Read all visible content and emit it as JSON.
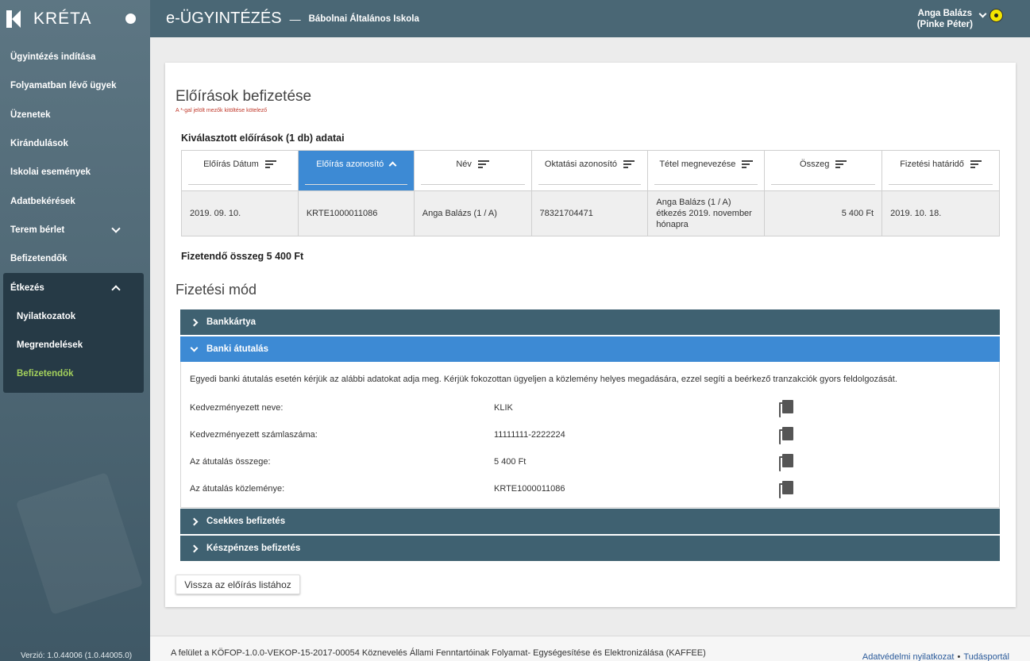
{
  "sidebar": {
    "logo": "KRÉTA",
    "items": [
      {
        "label": "Ügyintézés indítása"
      },
      {
        "label": "Folyamatban lévő ügyek"
      },
      {
        "label": "Üzenetek"
      },
      {
        "label": "Kirándulások"
      },
      {
        "label": "Iskolai események"
      },
      {
        "label": "Adatbekérések"
      },
      {
        "label": "Terem bérlet"
      },
      {
        "label": "Befizetendők"
      }
    ],
    "group": {
      "label": "Étkezés",
      "subitems": [
        {
          "label": "Nyilatkozatok"
        },
        {
          "label": "Megrendelések"
        },
        {
          "label": "Befizetendők"
        }
      ]
    },
    "version": "Verzió: 1.0.44006 (1.0.44005.0)"
  },
  "header": {
    "title": "e-ÜGYINTÉZÉS",
    "dash": "—",
    "school": "Bábolnai Általános Iskola",
    "user_name": "Anga Balázs",
    "user_sub": "(Pinke Péter)"
  },
  "page": {
    "title": "Előírások befizetése",
    "required_note": "A *-gal jelölt mezők kitöltése kötelező",
    "section_title": "Kiválasztott előírások (1 db) adatai",
    "columns": [
      "Előírás Dátum",
      "Előírás azonosító",
      "Név",
      "Oktatási azonosító",
      "Tétel megnevezése",
      "Összeg",
      "Fizetési határidő"
    ],
    "row": {
      "date": "2019. 09. 10.",
      "id": "KRTE1000011086",
      "name": "Anga Balázs (1 / A)",
      "edu_id": "78321704471",
      "item": "Anga Balázs (1 / A) étkezés 2019. november hónapra",
      "amount": "5 400 Ft",
      "deadline": "2019. 10. 18."
    },
    "total": "Fizetendő összeg 5 400 Ft",
    "payment_title": "Fizetési mód",
    "accordions": {
      "card": "Bankkártya",
      "transfer": "Banki átutalás",
      "cheque": "Csekkes befizetés",
      "cash": "Készpénzes befizetés"
    },
    "transfer": {
      "description": "Egyedi banki átutalás esetén kérjük az alábbi adatokat adja meg. Kérjük fokozottan ügyeljen a közlemény helyes megadására, ezzel segíti a beérkező tranzakciók gyors feldolgozását.",
      "fields": [
        {
          "label": "Kedvezményezett neve:",
          "value": "KLIK"
        },
        {
          "label": "Kedvezményezett számlaszáma:",
          "value": "11111111-2222224"
        },
        {
          "label": "Az átutalás összege:",
          "value": "5 400 Ft"
        },
        {
          "label": "Az átutalás közleménye:",
          "value": "KRTE1000011086"
        }
      ]
    },
    "back_button": "Vissza az előírás listához"
  },
  "footer": {
    "text": "A felület a KÖFOP-1.0.0-VEKOP-15-2017-00054 Köznevelés Állami Fenntartóinak Folyamat- Egységesítése és Elektronizálása (KAFFEE)",
    "link_privacy": "Adatvédelmi nyilatkozat",
    "sep": "•",
    "link_portal": "Tudásportál"
  },
  "icons": {
    "sort": "sort-lines-icon",
    "sort_active": "chevron-up-icon",
    "copy": "copy-icon",
    "accessibility": "accessibility-icon"
  },
  "colors": {
    "sidebar": "#4d6673",
    "header": "#4a6775",
    "accent": "#3d8ad4",
    "accordion": "#3f6171",
    "active_sub": "#a4d15c"
  }
}
